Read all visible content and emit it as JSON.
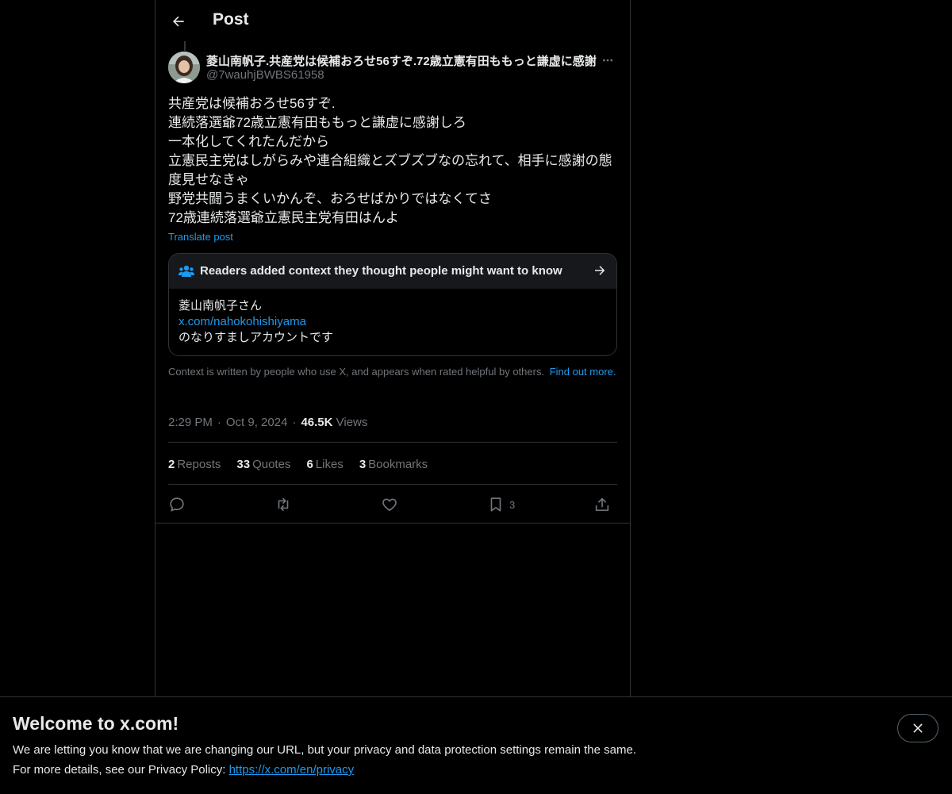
{
  "header": {
    "title": "Post"
  },
  "author": {
    "display_name": "菱山南帆子.共産党は候補おろせ56すぞ.72歳立憲有田ももっと謙虚に感謝",
    "handle": "@7wauhjBWBS61958"
  },
  "tweet": {
    "lines": [
      "共産党は候補おろせ56すぞ.",
      "連続落選爺72歳立憲有田ももっと謙虚に感謝しろ",
      "一本化してくれたんだから",
      "立憲民主党はしがらみや連合組織とズブズブなの忘れて、相手に感謝の態度見せなきゃ",
      "野党共闘うまくいかんぞ、おろせばかりではなくてさ",
      "72歳連続落選爺立憲民主党有田はんよ"
    ],
    "translate_label": "Translate post"
  },
  "community_note": {
    "header": "Readers added context they thought people might want to know",
    "body_line1": "菱山南帆子さん",
    "body_link": "x.com/nahokohishiyama",
    "body_line3": "のなりすましアカウントです",
    "footer_text": "Context is written by people who use X, and appears when rated helpful by others.",
    "footer_link": "Find out more."
  },
  "meta": {
    "time": "2:29 PM",
    "date": "Oct 9, 2024",
    "views_count": "46.5K",
    "views_label": "Views"
  },
  "stats": [
    {
      "count": "2",
      "label": "Reposts"
    },
    {
      "count": "33",
      "label": "Quotes"
    },
    {
      "count": "6",
      "label": "Likes"
    },
    {
      "count": "3",
      "label": "Bookmarks"
    }
  ],
  "actions": {
    "bookmark_count": "3"
  },
  "banner": {
    "title": "Welcome to x.com!",
    "line1": "We are letting you know that we are changing our URL, but your privacy and data protection settings remain the same.",
    "line2_prefix": "For more details, see our Privacy Policy: ",
    "line2_link": "https://x.com/en/privacy"
  },
  "colors": {
    "background": "#000000",
    "text": "#e7e9ea",
    "muted": "#71767b",
    "accent": "#1d9bf0",
    "border": "#2f3336"
  }
}
